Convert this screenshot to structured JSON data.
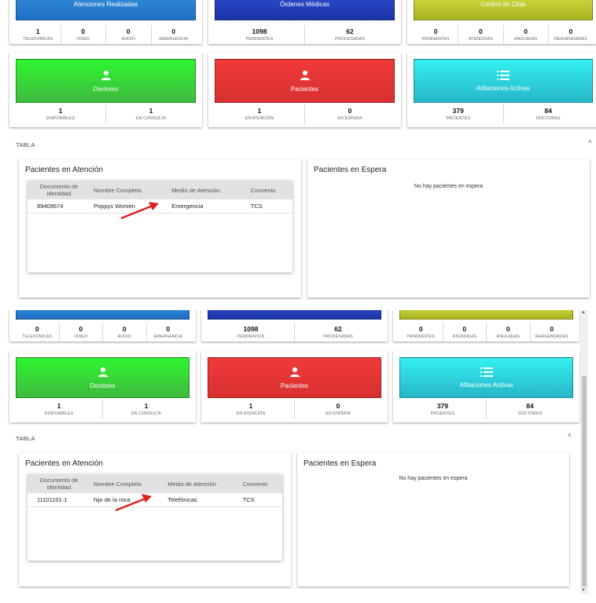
{
  "colors": {
    "atenciones": "#2a7fd4",
    "ordenes": "#2340b8",
    "citas": "#b9c42d",
    "doctores": "#33e333",
    "pacientes": "#e53535",
    "afiliaciones": "#2ed5e0",
    "arrow": "#e02020"
  },
  "icons": {
    "doctores": "person-icon",
    "pacientes": "person-icon",
    "afiliaciones": "list-icon",
    "collapse": "chevron-up-icon"
  },
  "shot1": {
    "atenciones": {
      "title": "Atenciones Realizadas",
      "stats": [
        {
          "value": "1",
          "label": "TELEFÓNICAS"
        },
        {
          "value": "0",
          "label": "VIDEO"
        },
        {
          "value": "0",
          "label": "AUDIO"
        },
        {
          "value": "0",
          "label": "EMERGENCIA"
        }
      ]
    },
    "ordenes": {
      "title": "Órdenes Médicas",
      "stats": [
        {
          "value": "1098",
          "label": "PENDIENTES"
        },
        {
          "value": "62",
          "label": "PROCESADAS"
        }
      ]
    },
    "citas": {
      "title": "Control de Citas",
      "stats": [
        {
          "value": "0",
          "label": "PENDIENTES"
        },
        {
          "value": "0",
          "label": "ATENDIDAS"
        },
        {
          "value": "0",
          "label": "ANULADAS"
        },
        {
          "value": "0",
          "label": "REAGENDADAS"
        }
      ]
    },
    "doctores": {
      "title": "Doctores",
      "stats": [
        {
          "value": "1",
          "label": "DISPONIBLES"
        },
        {
          "value": "1",
          "label": "EN CONSULTA"
        }
      ]
    },
    "pacientes": {
      "title": "Pacientes",
      "stats": [
        {
          "value": "1",
          "label": "EN ATENCIÓN"
        },
        {
          "value": "0",
          "label": "EN ESPERA"
        }
      ]
    },
    "afiliaciones": {
      "title": "Afiliaciones Activas",
      "stats": [
        {
          "value": "379",
          "label": "PACIENTES"
        },
        {
          "value": "84",
          "label": "DOCTORES"
        }
      ]
    },
    "section": "TABLA",
    "atencion_panel": {
      "title": "Pacientes en Atención",
      "columns": [
        "Documento de identidad",
        "Nombre Completo",
        "Medio de Atención",
        "Convenio"
      ],
      "rows": [
        [
          "89409674",
          "Poppys Women",
          "Emergencia",
          "TCS"
        ]
      ]
    },
    "espera_panel": {
      "title": "Pacientes en Espera",
      "empty": "No hay pacientes en espera"
    }
  },
  "shot2": {
    "atenciones": {
      "stats": [
        {
          "value": "0",
          "label": "TELEFÓNICAS"
        },
        {
          "value": "0",
          "label": "VIDEO"
        },
        {
          "value": "0",
          "label": "AUDIO"
        },
        {
          "value": "0",
          "label": "EMERGENCIA"
        }
      ]
    },
    "ordenes": {
      "stats": [
        {
          "value": "1098",
          "label": "PENDIENTES"
        },
        {
          "value": "62",
          "label": "PROCESADAS"
        }
      ]
    },
    "citas": {
      "stats": [
        {
          "value": "0",
          "label": "PENDIENTES"
        },
        {
          "value": "0",
          "label": "ATENDIDAS"
        },
        {
          "value": "0",
          "label": "ANULADAS"
        },
        {
          "value": "0",
          "label": "REAGENDADAS"
        }
      ]
    },
    "doctores": {
      "title": "Doctores",
      "stats": [
        {
          "value": "1",
          "label": "DISPONIBLES"
        },
        {
          "value": "1",
          "label": "EN CONSULTA"
        }
      ]
    },
    "pacientes": {
      "title": "Pacientes",
      "stats": [
        {
          "value": "1",
          "label": "EN ATENCIÓN"
        },
        {
          "value": "0",
          "label": "EN ESPERA"
        }
      ]
    },
    "afiliaciones": {
      "title": "Afiliaciones Activas",
      "stats": [
        {
          "value": "379",
          "label": "PACIENTES"
        },
        {
          "value": "84",
          "label": "DOCTORES"
        }
      ]
    },
    "section": "TABLA",
    "atencion_panel": {
      "title": "Pacientes en Atención",
      "columns": [
        "Documento de identidad",
        "Nombre Completo",
        "Medio de Atención",
        "Convenio"
      ],
      "rows": [
        [
          "11101101-1",
          "hijo de la roca",
          "Telefónicas",
          "TCS"
        ]
      ]
    },
    "espera_panel": {
      "title": "Pacientes en Espera",
      "empty": "No hay pacientes en espera"
    }
  }
}
